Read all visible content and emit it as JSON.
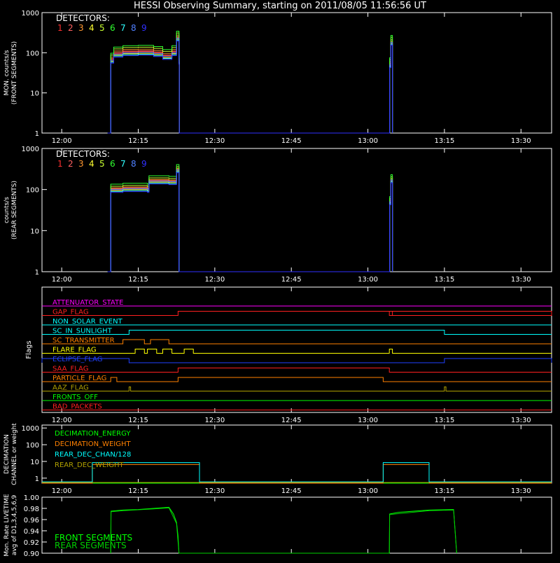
{
  "title": "HESSI Observing Summary, starting on 2011/08/05 11:56:56 UT",
  "colors": {
    "det": [
      "#ff3030",
      "#ff6060",
      "#ff9830",
      "#ffff30",
      "#c8ff30",
      "#30ff30",
      "#30ffff",
      "#5080ff",
      "#3030ff"
    ],
    "magenta": "#ff00ff",
    "red": "#ff2020",
    "cyan": "#00ffff",
    "orange": "#ff8000",
    "yellow": "#ffff00",
    "blue": "#2040ff",
    "olive": "#b0a000",
    "green": "#00ff00",
    "white": "#ffffff"
  },
  "chart_data": [
    {
      "type": "line",
      "panel": "front",
      "ylabel": [
        "MON. counts/s",
        "(FRONT SEGMENTS)"
      ],
      "yscale": "log",
      "ylim": [
        1,
        1000
      ],
      "xlim": [
        11.9356,
        13.6
      ],
      "yticks": [
        "1",
        "10",
        "100",
        "1000"
      ],
      "xticks": [
        "12:00",
        "12:15",
        "12:30",
        "12:45",
        "13:00",
        "13:15",
        "13:30"
      ],
      "legend_title": "DETECTORS:",
      "legend": [
        "1",
        "2",
        "3",
        "4",
        "5",
        "6",
        "7",
        "8",
        "9"
      ],
      "base": [
        [
          12.15,
          1
        ],
        [
          12.16,
          65
        ],
        [
          12.17,
          92
        ],
        [
          12.2,
          100
        ],
        [
          12.25,
          102
        ],
        [
          12.3,
          95
        ],
        [
          12.33,
          80
        ],
        [
          12.36,
          100
        ],
        [
          12.375,
          230
        ],
        [
          12.383,
          60
        ],
        [
          12.384,
          1
        ],
        [
          13.07,
          1
        ],
        [
          13.071,
          50
        ],
        [
          13.075,
          180
        ],
        [
          13.08,
          1
        ]
      ],
      "factors": [
        1.05,
        1.1,
        1.2,
        0.95,
        1.35,
        1.5,
        0.9,
        1.0,
        0.85
      ]
    },
    {
      "type": "line",
      "panel": "rear",
      "ylabel": [
        "counts/s",
        "(REAR SEGMENTS)"
      ],
      "yscale": "log",
      "ylim": [
        1,
        1000
      ],
      "xlim": [
        11.9356,
        13.6
      ],
      "yticks": [
        "1",
        "10",
        "100",
        "1000"
      ],
      "xticks": [
        "12:00",
        "12:15",
        "12:30",
        "12:45",
        "13:00",
        "13:15",
        "13:30"
      ],
      "legend_title": "DETECTORS:",
      "legend": [
        "1",
        "2",
        "3",
        "4",
        "5",
        "6",
        "7",
        "8",
        "9"
      ],
      "base": [
        [
          12.15,
          1
        ],
        [
          12.16,
          100
        ],
        [
          12.2,
          105
        ],
        [
          12.28,
          100
        ],
        [
          12.285,
          160
        ],
        [
          12.35,
          155
        ],
        [
          12.375,
          300
        ],
        [
          12.383,
          1
        ],
        [
          13.07,
          1
        ],
        [
          13.071,
          50
        ],
        [
          13.075,
          170
        ],
        [
          13.08,
          1
        ]
      ],
      "factors": [
        1.0,
        1.05,
        1.1,
        0.95,
        1.2,
        1.35,
        0.9,
        1.0,
        0.85
      ]
    },
    {
      "type": "step",
      "panel": "flags",
      "ylabel": "Flags",
      "xlim": [
        11.9356,
        13.6
      ],
      "xticks": [
        "12:00",
        "12:15",
        "12:30",
        "12:45",
        "13:00",
        "13:15",
        "13:30"
      ],
      "flags": [
        {
          "name": "ATTENUATOR_STATE",
          "color": "#ff00ff",
          "on": []
        },
        {
          "name": "GAP_FLAG",
          "color": "#ff2020",
          "on": [
            [
              12.38,
              13.6
            ],
            [
              13.07,
              13.08
            ]
          ]
        },
        {
          "name": "NON_SOLAR_EVENT",
          "color": "#00ffff",
          "on": []
        },
        {
          "name": "SC_IN_SUNLIGHT",
          "color": "#00ffff",
          "on": [
            [
              12.22,
              13.25
            ]
          ]
        },
        {
          "name": "SC_TRANSMITTER",
          "color": "#ff8000",
          "on": [
            [
              12.2,
              12.27
            ],
            [
              12.29,
              12.35
            ]
          ]
        },
        {
          "name": "FLARE_FLAG",
          "color": "#ffff00",
          "on": [
            [
              12.24,
              12.27
            ],
            [
              12.28,
              12.31
            ],
            [
              12.33,
              12.36
            ],
            [
              12.4,
              12.43
            ],
            [
              13.07,
              13.08
            ]
          ]
        },
        {
          "name": "ECLIPSE_FLAG",
          "color": "#2040ff",
          "on": [
            [
              11.9356,
              12.22
            ],
            [
              13.25,
              13.6
            ]
          ]
        },
        {
          "name": "SAA_FLAG",
          "color": "#ff2020",
          "on": [
            [
              12.38,
              13.07
            ]
          ]
        },
        {
          "name": "PARTICLE_FLAG",
          "color": "#ff8000",
          "on": [
            [
              12.16,
              12.18
            ],
            [
              12.38,
              13.05
            ]
          ]
        },
        {
          "name": "AAZ_FLAG",
          "color": "#b0a000",
          "on": [
            [
              12.22,
              12.225
            ],
            [
              13.25,
              13.255
            ]
          ]
        },
        {
          "name": "FRONTS_OFF",
          "color": "#00ff00",
          "on": []
        },
        {
          "name": "BAD_PACKETS",
          "color": "#ff2020",
          "on": []
        }
      ]
    },
    {
      "type": "step",
      "panel": "decimation",
      "ylabel": [
        "DECIMATION",
        "CHANNEL or weight"
      ],
      "yscale": "log",
      "ylim": [
        0.5,
        1500
      ],
      "xlim": [
        11.9356,
        13.6
      ],
      "yticks": [
        "1",
        "10",
        "100",
        "1000"
      ],
      "xticks": [
        "12:00",
        "12:15",
        "12:30",
        "12:45",
        "13:00",
        "13:15",
        "13:30"
      ],
      "series": [
        {
          "name": "DECIMATION_ENERGY",
          "color": "#00ff00",
          "values": [
            [
              11.9356,
              0.5
            ],
            [
              13.6,
              0.5
            ]
          ]
        },
        {
          "name": "DECIMATION_WEIGHT",
          "color": "#ff8000",
          "values": [
            [
              11.9356,
              0.5
            ],
            [
              12.1,
              0.5
            ],
            [
              12.1,
              6.5
            ],
            [
              12.45,
              6.5
            ],
            [
              12.45,
              0.5
            ],
            [
              13.05,
              0.5
            ],
            [
              13.05,
              6.5
            ],
            [
              13.2,
              6.5
            ],
            [
              13.2,
              0.5
            ],
            [
              13.6,
              0.5
            ]
          ]
        },
        {
          "name": "REAR_DEC_CHAN/128",
          "color": "#00ffff",
          "values": [
            [
              11.9356,
              0.6
            ],
            [
              12.1,
              0.6
            ],
            [
              12.1,
              8.5
            ],
            [
              12.45,
              8.5
            ],
            [
              12.45,
              0.6
            ],
            [
              13.05,
              0.6
            ],
            [
              13.05,
              8.5
            ],
            [
              13.2,
              8.5
            ],
            [
              13.2,
              0.6
            ],
            [
              13.6,
              0.6
            ]
          ]
        },
        {
          "name": "REAR_DEC_WEIGHT",
          "color": "#b0a000",
          "values": [
            [
              11.9356,
              0.55
            ],
            [
              13.6,
              0.55
            ]
          ]
        }
      ]
    },
    {
      "type": "line",
      "panel": "livetime",
      "ylabel": [
        "Mon. Rate LIVETIME",
        "avg of D1,3,4,5,6,9"
      ],
      "ylim": [
        0.9,
        1.0
      ],
      "xlim": [
        11.9356,
        13.6
      ],
      "yticks": [
        "0.90",
        "0.92",
        "0.94",
        "0.96",
        "0.98",
        "1.00"
      ],
      "legend": [
        "FRONT SEGMENTS",
        "REAR SEGMENTS"
      ],
      "series": [
        {
          "name": "FRONT SEGMENTS",
          "color": "#00ff00",
          "values": [
            [
              12.16,
              0.9
            ],
            [
              12.161,
              0.975
            ],
            [
              12.2,
              0.977
            ],
            [
              12.25,
              0.978
            ],
            [
              12.3,
              0.98
            ],
            [
              12.35,
              0.982
            ],
            [
              12.365,
              0.97
            ],
            [
              12.375,
              0.955
            ],
            [
              12.38,
              0.93
            ],
            [
              12.383,
              0.9
            ],
            [
              13.07,
              0.9
            ],
            [
              13.071,
              0.97
            ],
            [
              13.1,
              0.973
            ],
            [
              13.2,
              0.977
            ],
            [
              13.28,
              0.978
            ],
            [
              13.29,
              0.9
            ]
          ]
        },
        {
          "name": "REAR SEGMENTS",
          "color": "#00d000",
          "values": [
            [
              12.16,
              0.9
            ],
            [
              12.161,
              0.974
            ],
            [
              12.2,
              0.976
            ],
            [
              12.3,
              0.979
            ],
            [
              12.35,
              0.981
            ],
            [
              12.375,
              0.953
            ],
            [
              12.383,
              0.9
            ],
            [
              13.07,
              0.9
            ],
            [
              13.071,
              0.969
            ],
            [
              13.2,
              0.976
            ],
            [
              13.28,
              0.977
            ],
            [
              13.29,
              0.9
            ]
          ]
        }
      ]
    }
  ]
}
